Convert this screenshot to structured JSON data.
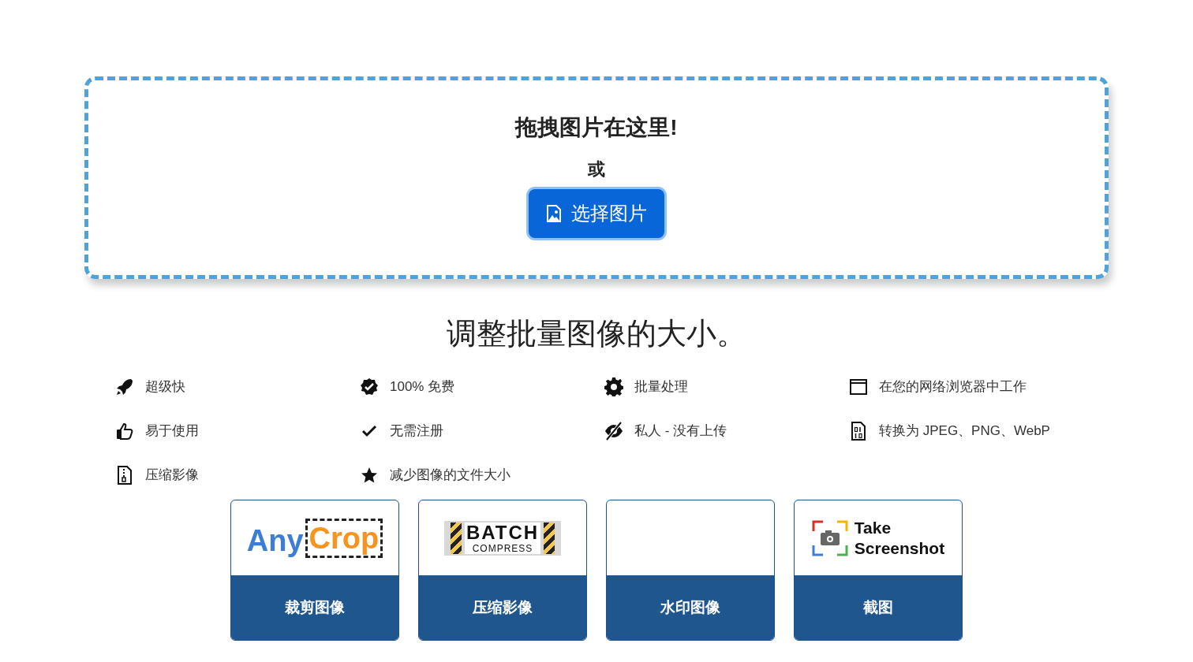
{
  "drop_zone": {
    "heading": "拖拽图片在这里!",
    "separator": "或",
    "button": "选择图片"
  },
  "title": "调整批量图像的大小。",
  "features": [
    {
      "label": "超级快"
    },
    {
      "label": "100% 免费"
    },
    {
      "label": "批量处理"
    },
    {
      "label": "在您的网络浏览器中工作"
    },
    {
      "label": "易于使用"
    },
    {
      "label": "无需注册"
    },
    {
      "label": "私人 - 没有上传"
    },
    {
      "label": "转换为 JPEG、PNG、WebP"
    },
    {
      "label": "压缩影像"
    },
    {
      "label": "减少图像的文件大小"
    }
  ],
  "tools": [
    {
      "logo": {
        "kind": "anycrop",
        "words": [
          "Any",
          "Crop"
        ]
      },
      "label": "裁剪图像"
    },
    {
      "logo": {
        "kind": "batch",
        "words": [
          "BATCH",
          "COMPRESS"
        ]
      },
      "label": "压缩影像"
    },
    {
      "label": "水印图像"
    },
    {
      "logo": {
        "kind": "camera",
        "words": [
          "Take",
          "Screenshot"
        ]
      },
      "label": "截图"
    }
  ]
}
